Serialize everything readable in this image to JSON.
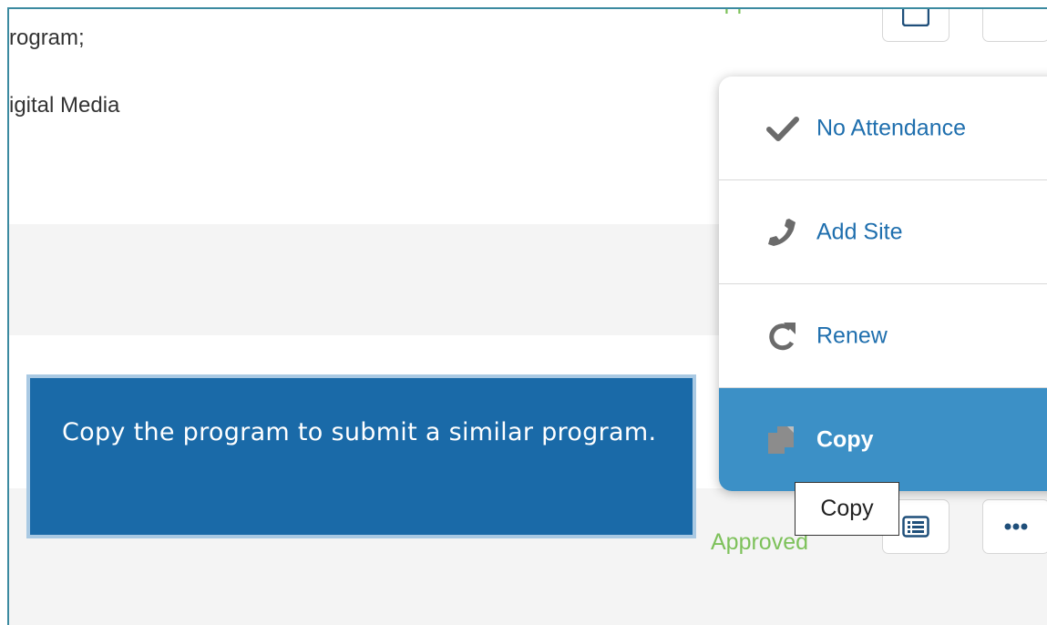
{
  "rows": [
    {
      "text": "rogram;",
      "status": "Approved"
    },
    {
      "text": "igital Media",
      "status": ""
    },
    {
      "text": "",
      "status": ""
    },
    {
      "text": "",
      "status": ""
    },
    {
      "text": "",
      "status": "Approved"
    }
  ],
  "menu": {
    "items": [
      {
        "label": "No Attendance",
        "icon": "check-icon"
      },
      {
        "label": "Add Site",
        "icon": "phone-icon"
      },
      {
        "label": "Renew",
        "icon": "redo-icon"
      },
      {
        "label": "Copy",
        "icon": "copy-icon",
        "active": true
      }
    ]
  },
  "tooltip": {
    "text": "Copy"
  },
  "callout": {
    "text": "Copy the program to submit a similar program."
  },
  "colors": {
    "approved": "#7dc15a",
    "menu_active": "#3c90c6",
    "menu_link": "#1f6fae",
    "callout_bg": "#1a6aa8"
  }
}
